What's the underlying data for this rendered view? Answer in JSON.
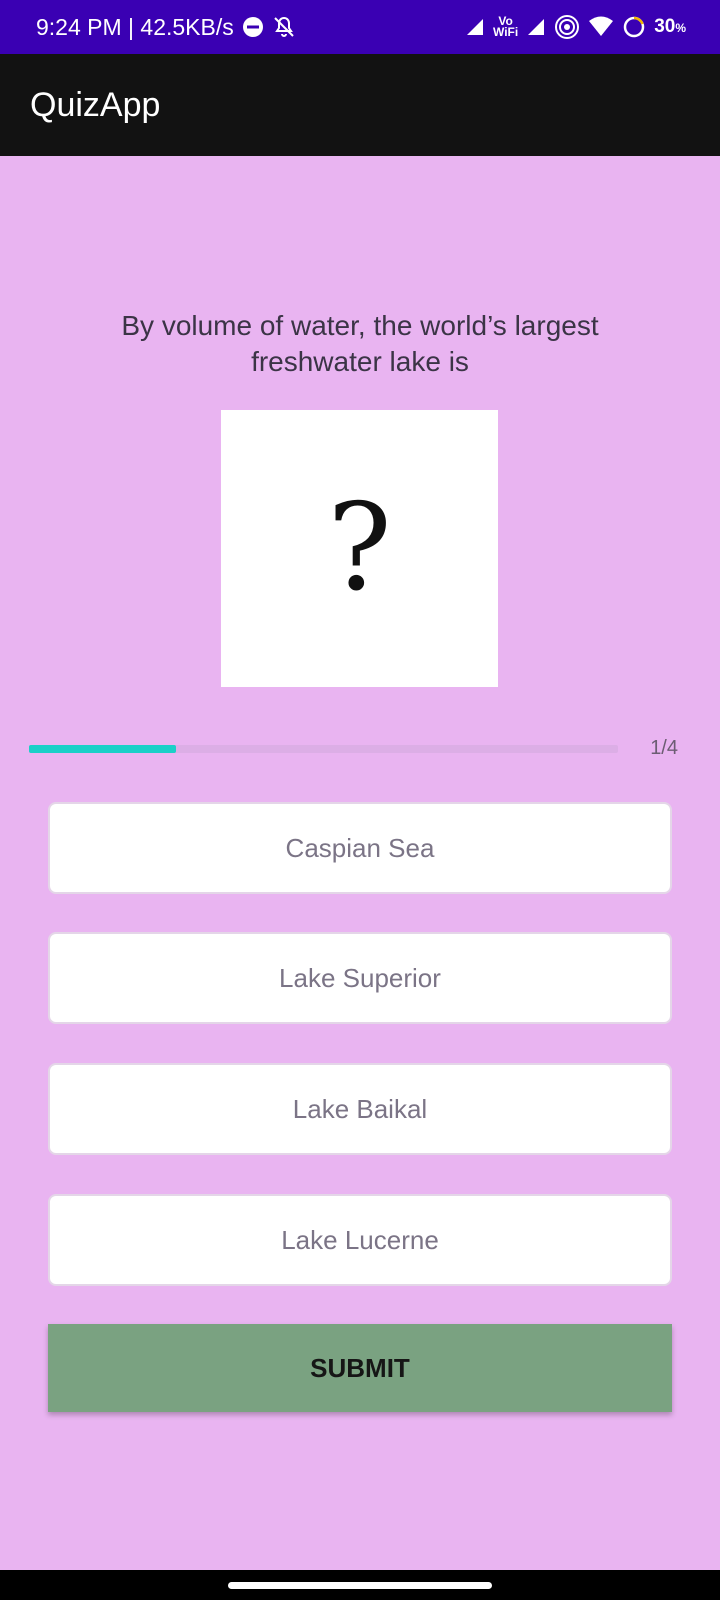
{
  "status_bar": {
    "time_speed": "9:24 PM | 42.5KB/s",
    "vowifi_top": "Vo",
    "vowifi_bottom": "WiFi",
    "battery_percent": "30",
    "battery_unit": "%",
    "icons": [
      "dnd-icon",
      "notifications-off-icon",
      "signal-icon",
      "vowifi-icon",
      "signal-icon",
      "hotspot-icon",
      "wifi-icon",
      "battery-saver-ring-icon"
    ]
  },
  "app_bar": {
    "title": "QuizApp"
  },
  "quiz": {
    "question": "By volume of water, the world’s largest freshwater lake is",
    "image_glyph": "?",
    "progress_text": "1/4",
    "progress_value": 0.25,
    "options": [
      {
        "label": "Caspian Sea"
      },
      {
        "label": "Lake Superior"
      },
      {
        "label": "Lake Baikal"
      },
      {
        "label": "Lake Lucerne"
      }
    ],
    "submit_label": "SUBMIT"
  },
  "colors": {
    "background": "#e9b4f1",
    "status_bar": "#3a00b3",
    "app_bar": "#121212",
    "progress_fill": "#1ad0c8",
    "submit": "#7aa281"
  }
}
